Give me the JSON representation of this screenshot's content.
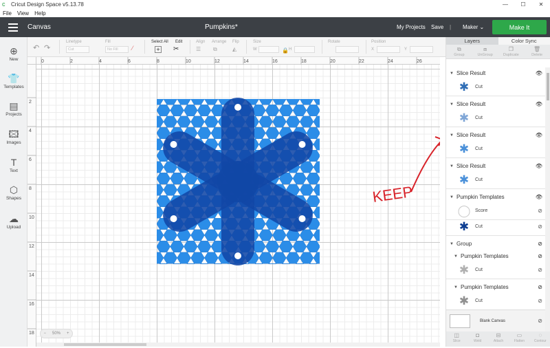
{
  "window": {
    "title": "Cricut Design Space   v5.13.78",
    "min_label": "—",
    "max_label": "☐",
    "close_label": "✕"
  },
  "menu": [
    "File",
    "View",
    "Help"
  ],
  "header": {
    "canvas": "Canvas",
    "doc_title": "Pumpkins*",
    "my_projects": "My Projects",
    "save": "Save",
    "divider": "|",
    "machine": "Maker",
    "make_it": "Make It"
  },
  "leftbar": [
    {
      "label": "New",
      "icon": "plus-circle-icon",
      "glyph": "⊕"
    },
    {
      "label": "Templates",
      "icon": "shirt-icon",
      "glyph": "👕"
    },
    {
      "label": "Projects",
      "icon": "projects-icon",
      "glyph": "▤"
    },
    {
      "label": "Images",
      "icon": "image-icon",
      "glyph": "🖾"
    },
    {
      "label": "Text",
      "icon": "text-icon",
      "glyph": "T"
    },
    {
      "label": "Shapes",
      "icon": "shapes-icon",
      "glyph": "⬡"
    },
    {
      "label": "Upload",
      "icon": "upload-icon",
      "glyph": "☁"
    }
  ],
  "toolbar": {
    "linetype": "Linetype",
    "linetype_value": "Cut",
    "fill": "Fill",
    "fill_value": "No Fill",
    "select_all": "Select All",
    "edit": "Edit",
    "align": "Align",
    "arrange": "Arrange",
    "flip": "Flip",
    "size": "Size",
    "size_w": "W",
    "size_h": "H",
    "rotate": "Rotate",
    "position": "Position",
    "pos_x": "X",
    "pos_y": "Y"
  },
  "ruler": {
    "top": [
      "0",
      "2",
      "4",
      "6",
      "8",
      "10",
      "12",
      "14",
      "16",
      "18",
      "20",
      "22",
      "24",
      "26"
    ],
    "left": [
      "2",
      "4",
      "6",
      "8",
      "10",
      "12",
      "14",
      "16",
      "18"
    ]
  },
  "zoom": {
    "minus": "−",
    "value": "50%",
    "plus": "+"
  },
  "annotation": {
    "text": "KEEP",
    "color": "#d8232a"
  },
  "panel": {
    "tabs": [
      "Layers",
      "Color Sync"
    ],
    "actions": [
      "Group",
      "UnGroup",
      "Duplicate",
      "Delete"
    ],
    "layers": [
      {
        "title": "Slice Result",
        "op": "Cut",
        "thumb_color": "#2f6db5"
      },
      {
        "title": "Slice Result",
        "op": "Cut",
        "thumb_color": "#7fa6d6"
      },
      {
        "title": "Slice Result",
        "op": "Cut",
        "thumb_color": "#4a90d9"
      },
      {
        "title": "Slice Result",
        "op": "Cut",
        "thumb_color": "#4a90d9"
      },
      {
        "title": "Pumpkin Templates",
        "op1": "Score",
        "op2": "Cut",
        "thumb_color": "#0d3d91"
      },
      {
        "title": "Group"
      },
      {
        "title": "Pumpkin Templates",
        "op": "Cut",
        "thumb_color": "#b0b0b0"
      },
      {
        "title": "Pumpkin Templates",
        "op": "Cut",
        "thumb_color": "#909090"
      }
    ],
    "blank_canvas": "Blank Canvas",
    "bottom_actions": [
      "Slice",
      "Weld",
      "Attach",
      "Flatten",
      "Contour"
    ]
  },
  "colors": {
    "header": "#3c4045",
    "make_it": "#2ea84a",
    "hex_fill": "#2b8de8",
    "hex_dark": "#1a5fae",
    "flower": "#1147a6"
  }
}
